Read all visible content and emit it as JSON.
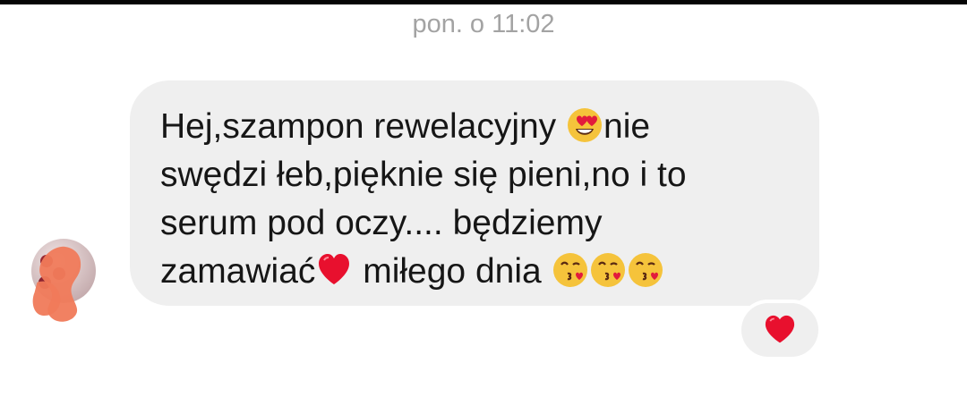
{
  "conversation": {
    "timestamp": "pon. o 11:02"
  },
  "message": {
    "line1_a": "Hej,szampon rewelacyjny ",
    "line1_b": "nie",
    "line2": "swędzi łeb,pięknie się pieni,no i to",
    "line3": "serum pod oczy.... będziemy",
    "line4_a": "zamawiać",
    "line4_b": " miłego dnia ",
    "emoji_1": "heart-eyes-icon",
    "emoji_2": "red-heart-icon",
    "emoji_3": "kissing-heart-icon"
  },
  "reaction": {
    "icon": "red-heart-icon"
  },
  "colors": {
    "bubble": "#efefef",
    "timestamp": "#a3a3a3",
    "heart": "#e8102e",
    "avatar_mask": "#f07a5a"
  }
}
